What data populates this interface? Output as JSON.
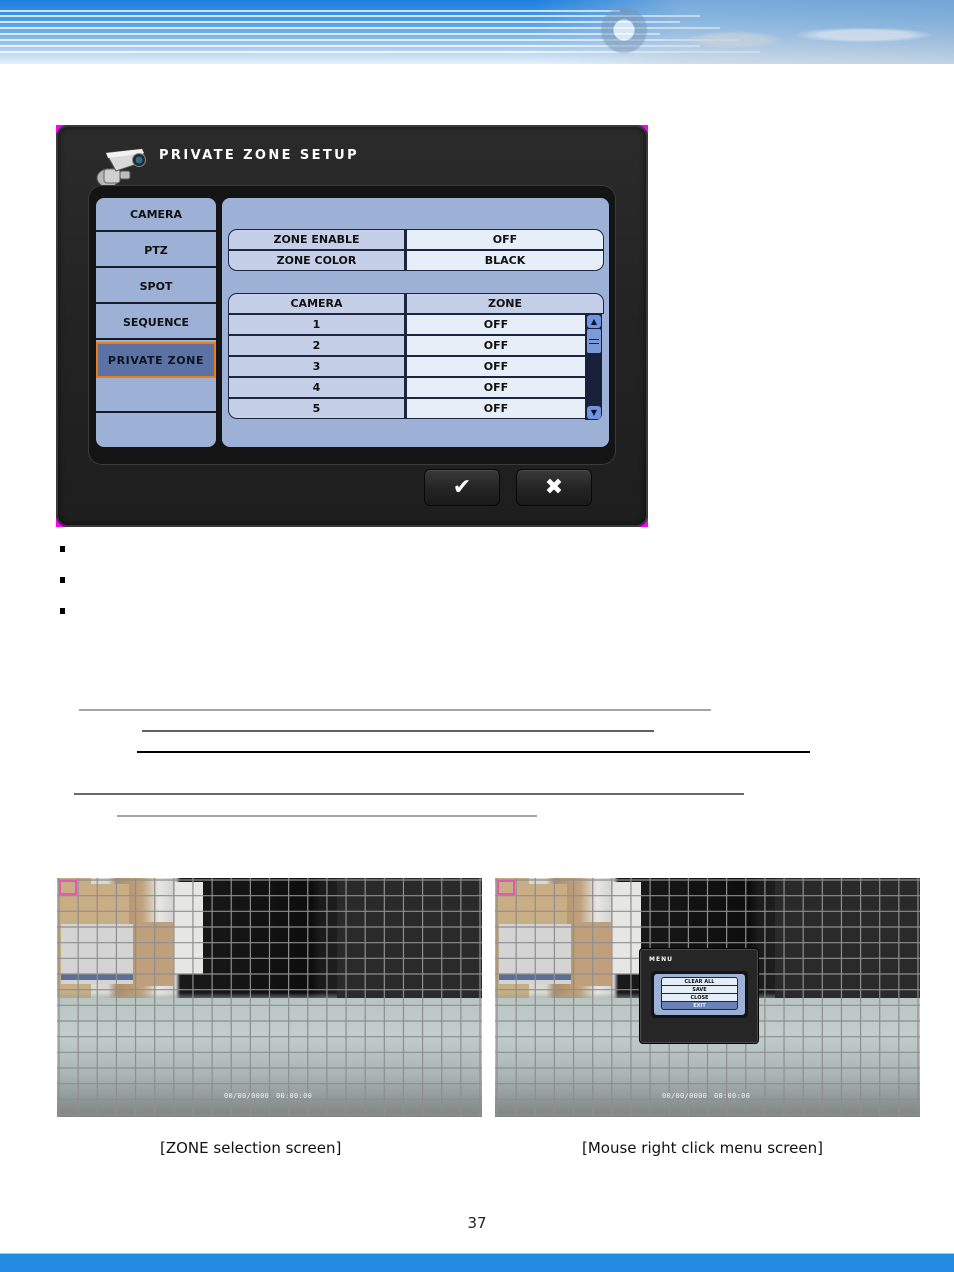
{
  "page": {
    "number": "37",
    "colors": {
      "banner_blue": "#1d7fde",
      "footer_blue": "#238be2",
      "panel_blue": "#9db0d6",
      "active_outline": "#f07d14",
      "selection_marker": "#e05ab0"
    }
  },
  "dvr_dialog": {
    "title": "PRIVATE ZONE SETUP",
    "title_icon": "security-camera-icon",
    "menu": [
      {
        "label": "CAMERA",
        "active": false
      },
      {
        "label": "PTZ",
        "active": false
      },
      {
        "label": "SPOT",
        "active": false
      },
      {
        "label": "SEQUENCE",
        "active": false
      },
      {
        "label": "PRIVATE ZONE",
        "active": true
      },
      {
        "label": "",
        "active": false
      },
      {
        "label": "",
        "active": false
      }
    ],
    "settings": [
      {
        "label": "ZONE ENABLE",
        "value": "OFF"
      },
      {
        "label": "ZONE COLOR",
        "value": "BLACK"
      }
    ],
    "zone_table": {
      "headers": [
        "CAMERA",
        "ZONE"
      ],
      "rows": [
        {
          "camera": "1",
          "zone": "OFF"
        },
        {
          "camera": "2",
          "zone": "OFF"
        },
        {
          "camera": "3",
          "zone": "OFF"
        },
        {
          "camera": "4",
          "zone": "OFF"
        },
        {
          "camera": "5",
          "zone": "OFF"
        }
      ],
      "scroll_up_icon": "▲",
      "scroll_down_icon": "▼"
    },
    "buttons": {
      "ok": {
        "icon": "✔",
        "name": "checkmark-icon"
      },
      "cancel": {
        "icon": "✖",
        "name": "close-icon"
      }
    }
  },
  "screenshots": [
    {
      "caption": "[ZONE selection screen]",
      "timestamp_date": "00/00/0000",
      "timestamp_time": "00:00:00"
    },
    {
      "caption": "[Mouse right click menu screen]",
      "timestamp_date": "00/00/0000",
      "timestamp_time": "00:00:00",
      "popup": {
        "title": "MENU",
        "items": [
          "CLEAR ALL",
          "SAVE",
          "CLOSE",
          "EXIT"
        ]
      }
    }
  ]
}
